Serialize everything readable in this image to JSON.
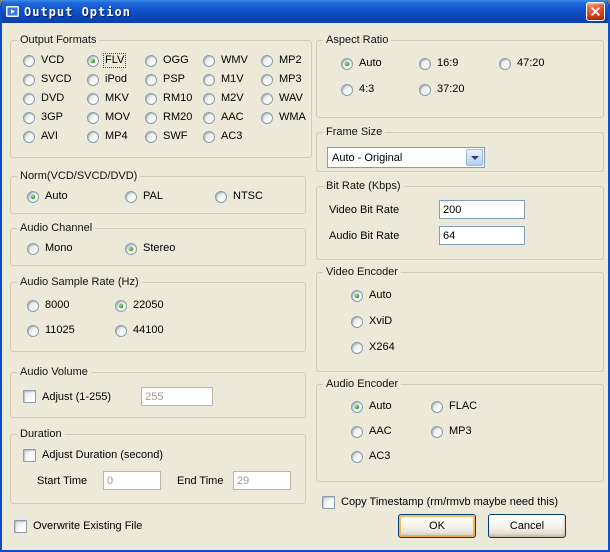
{
  "window": {
    "title": "Output Option"
  },
  "colors": {
    "titlebar_blue": "#1153C8",
    "close_red": "#D9441A",
    "dialog_bg": "#ECE9D8",
    "radio_dot_green": "#249A24",
    "field_border": "#7F9DB9",
    "ok_focus_glow": "#F6AA3C"
  },
  "output_formats": {
    "title": "Output Formats",
    "items": [
      {
        "label": "VCD",
        "checked": false
      },
      {
        "label": "FLV",
        "checked": true,
        "focused": true
      },
      {
        "label": "OGG",
        "checked": false
      },
      {
        "label": "WMV",
        "checked": false
      },
      {
        "label": "MP2",
        "checked": false
      },
      {
        "label": "SVCD",
        "checked": false
      },
      {
        "label": "iPod",
        "checked": false
      },
      {
        "label": "PSP",
        "checked": false
      },
      {
        "label": "M1V",
        "checked": false
      },
      {
        "label": "MP3",
        "checked": false
      },
      {
        "label": "DVD",
        "checked": false
      },
      {
        "label": "MKV",
        "checked": false
      },
      {
        "label": "RM10",
        "checked": false
      },
      {
        "label": "M2V",
        "checked": false
      },
      {
        "label": "WAV",
        "checked": false
      },
      {
        "label": "3GP",
        "checked": false
      },
      {
        "label": "MOV",
        "checked": false
      },
      {
        "label": "RM20",
        "checked": false
      },
      {
        "label": "AAC",
        "checked": false
      },
      {
        "label": "WMA",
        "checked": false
      },
      {
        "label": "AVI",
        "checked": false
      },
      {
        "label": "MP4",
        "checked": false
      },
      {
        "label": "SWF",
        "checked": false
      },
      {
        "label": "AC3",
        "checked": false
      }
    ]
  },
  "norm": {
    "title": "Norm(VCD/SVCD/DVD)",
    "items": [
      {
        "label": "Auto",
        "checked": true
      },
      {
        "label": "PAL",
        "checked": false
      },
      {
        "label": "NTSC",
        "checked": false
      }
    ]
  },
  "audio_channel": {
    "title": "Audio Channel",
    "items": [
      {
        "label": "Mono",
        "checked": false
      },
      {
        "label": "Stereo",
        "checked": true
      }
    ]
  },
  "sample_rate": {
    "title": "Audio Sample Rate (Hz)",
    "items": [
      {
        "label": "8000",
        "checked": false
      },
      {
        "label": "22050",
        "checked": true
      },
      {
        "label": "11025",
        "checked": false
      },
      {
        "label": "44100",
        "checked": false
      }
    ]
  },
  "audio_volume": {
    "title": "Audio Volume",
    "checkbox_label": "Adjust (1-255)",
    "checked": false,
    "value": "255"
  },
  "duration": {
    "title": "Duration",
    "checkbox_label": "Adjust Duration (second)",
    "checked": false,
    "start_label": "Start Time",
    "start_value": "0",
    "end_label": "End Time",
    "end_value": "29"
  },
  "overwrite": {
    "label": "Overwrite Existing File",
    "checked": false
  },
  "aspect_ratio": {
    "title": "Aspect Ratio",
    "items": [
      {
        "label": "Auto",
        "checked": true
      },
      {
        "label": "16:9",
        "checked": false
      },
      {
        "label": "47:20",
        "checked": false
      },
      {
        "label": "4:3",
        "checked": false
      },
      {
        "label": "37:20",
        "checked": false
      }
    ]
  },
  "frame_size": {
    "title": "Frame Size",
    "value": "Auto - Original"
  },
  "bit_rate": {
    "title": "Bit Rate (Kbps)",
    "video_label": "Video Bit Rate",
    "video_value": "200",
    "audio_label": "Audio Bit Rate",
    "audio_value": "64"
  },
  "video_encoder": {
    "title": "Video Encoder",
    "items": [
      {
        "label": "Auto",
        "checked": true
      },
      {
        "label": "XviD",
        "checked": false
      },
      {
        "label": "X264",
        "checked": false
      }
    ]
  },
  "audio_encoder": {
    "title": "Audio Encoder",
    "items": [
      {
        "label": "Auto",
        "checked": true
      },
      {
        "label": "FLAC",
        "checked": false
      },
      {
        "label": "AAC",
        "checked": false
      },
      {
        "label": "MP3",
        "checked": false
      },
      {
        "label": "AC3",
        "checked": false
      }
    ]
  },
  "copy_timestamp": {
    "label": "Copy Timestamp (rm/rmvb maybe need this)",
    "checked": false
  },
  "buttons": {
    "ok": "OK",
    "cancel": "Cancel"
  }
}
